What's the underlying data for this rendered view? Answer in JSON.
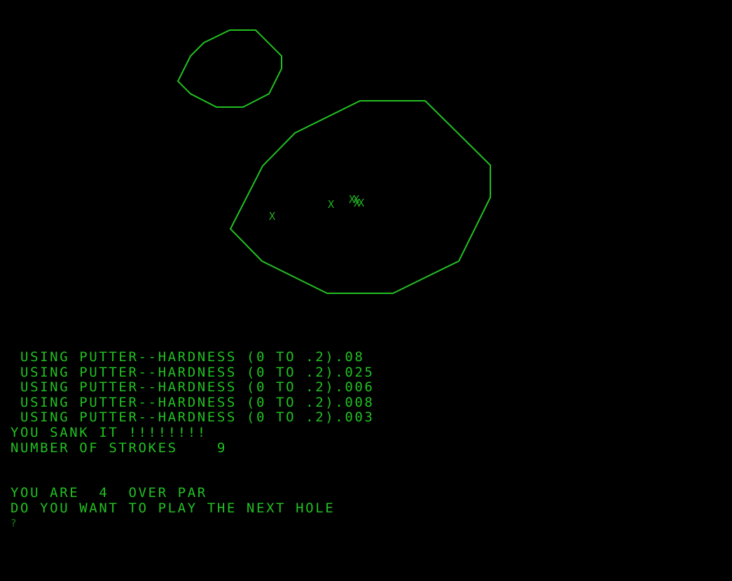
{
  "colors": {
    "background": "#000000",
    "course_outline": "#22c022",
    "text": "#22c022",
    "ball_marks": "#22b322"
  },
  "course": {
    "green_shape": "irregular polygon",
    "hazard_shape": "irregular polygon",
    "ball_marks": [
      "X",
      "X",
      "XX"
    ]
  },
  "terminal": {
    "lines": [
      " USING PUTTER--HARDNESS (0 TO .2).08",
      " USING PUTTER--HARDNESS (0 TO .2).025",
      " USING PUTTER--HARDNESS (0 TO .2).006",
      " USING PUTTER--HARDNESS (0 TO .2).008",
      " USING PUTTER--HARDNESS (0 TO .2).003",
      "YOU SANK IT !!!!!!!!",
      "NUMBER OF STROKES    9",
      "",
      "",
      "YOU ARE  4  OVER PAR",
      "DO YOU WANT TO PLAY THE NEXT HOLE"
    ],
    "prompt": "?"
  }
}
